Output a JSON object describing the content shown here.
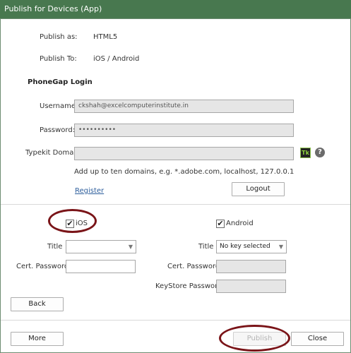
{
  "window": {
    "title": "Publish for Devices (App)"
  },
  "publish": {
    "as_label": "Publish as:",
    "as_value": "HTML5",
    "to_label": "Publish To:",
    "to_value": "iOS / Android"
  },
  "login": {
    "heading": "PhoneGap Login",
    "username_label": "Username:",
    "username_value": "ckshah@excelcomputerinstitute.in",
    "password_label": "Password:",
    "password_value": "••••••••••",
    "typekit_label": "Typekit Domains:",
    "typekit_value": "",
    "tk_badge": "Tk",
    "help_glyph": "?",
    "hint": "Add up to ten domains, e.g. *.adobe.com, localhost, 127.0.0.1",
    "register_link": "Register",
    "logout_button": "Logout"
  },
  "ios": {
    "label": "iOS",
    "checked": true,
    "title_label": "Title",
    "title_value": "",
    "cert_label": "Cert. Password",
    "cert_value": "",
    "back_button": "Back"
  },
  "android": {
    "label": "Android",
    "checked": true,
    "title_label": "Title",
    "title_value": "No key selected",
    "cert_label": "Cert. Password",
    "cert_value": "",
    "keystore_label": "KeyStore Password",
    "keystore_value": ""
  },
  "footer": {
    "more_button": "More",
    "publish_button": "Publish",
    "close_button": "Close"
  },
  "check_glyph": "✔",
  "dropdown_glyph": "▼",
  "annotation_color": "#7a1418"
}
